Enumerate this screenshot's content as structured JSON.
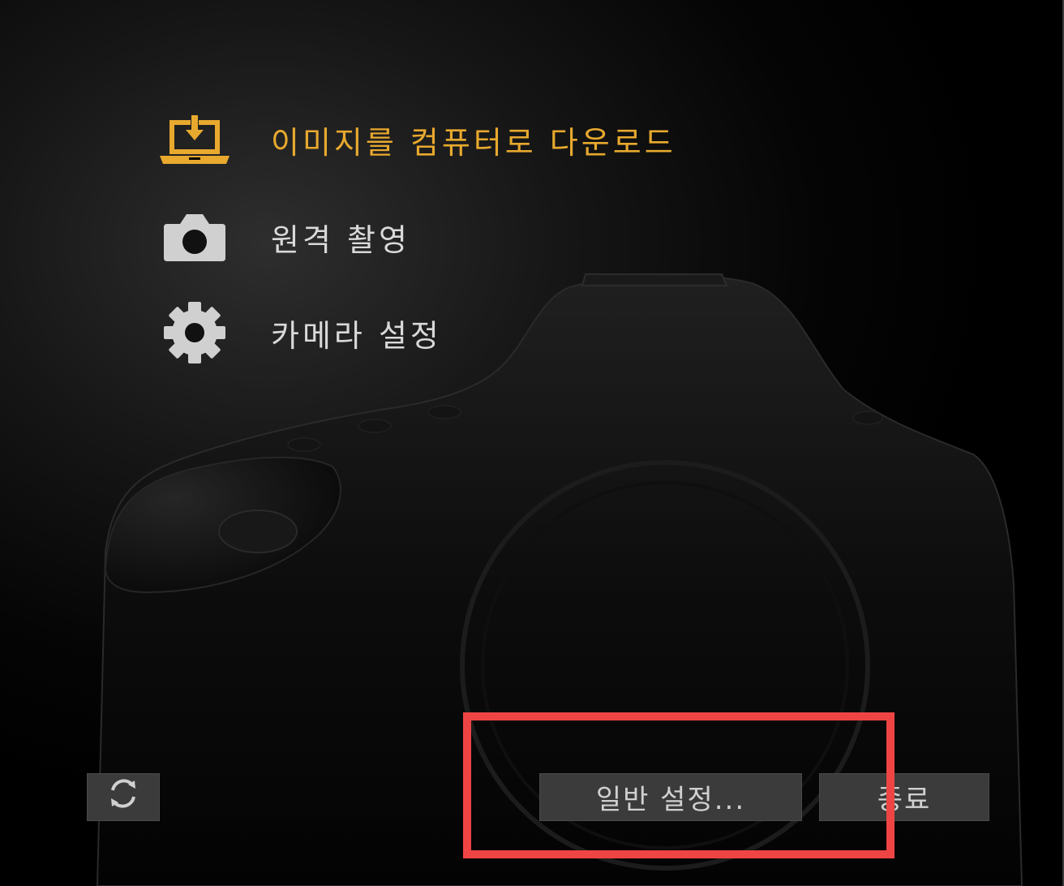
{
  "menu": {
    "items": [
      {
        "label": "이미지를 컴퓨터로 다운로드",
        "icon": "download-to-laptop-icon",
        "active": true
      },
      {
        "label": "원격 촬영",
        "icon": "camera-icon",
        "active": false
      },
      {
        "label": "카메라 설정",
        "icon": "gear-icon",
        "active": false
      }
    ]
  },
  "footer": {
    "refresh_icon": "refresh-icon",
    "general_settings_label": "일반 설정...",
    "exit_label": "종료"
  },
  "colors": {
    "accent": "#e8a92e",
    "menu_text": "#d9d9d9",
    "button_bg": "#3b3b3b",
    "highlight": "#ef4444"
  }
}
